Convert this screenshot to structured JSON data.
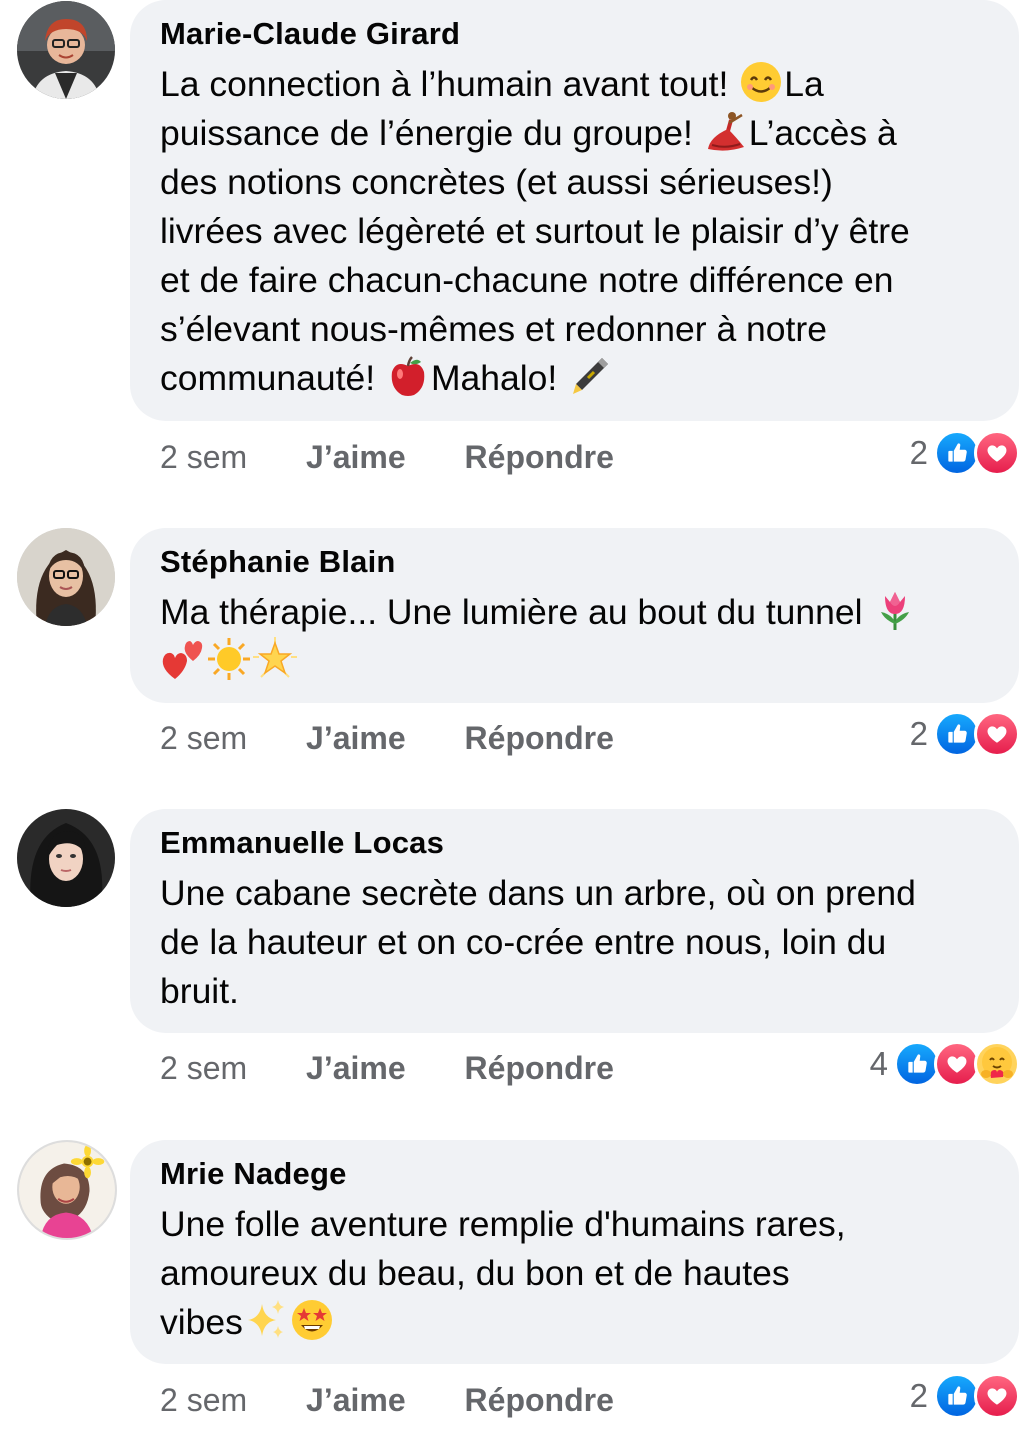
{
  "comments": [
    {
      "author": "Marie-Claude Girard",
      "text_parts": [
        "La connection à l’humain avant tout! ",
        "La\npuissance de l’énergie du groupe! ",
        "L’accès à\ndes notions concrètes (et aussi sérieuses!)\nlivrées avec légèreté et surtout le plaisir d’y être\net de faire chacun-chacune notre différence en\ns’élevant nous-mêmes et redonner à notre\ncommunauté! ",
        "Mahalo! "
      ],
      "emojis": [
        "smiling-face-emoji",
        "dancer-emoji",
        "apple-emoji",
        "pen-emoji"
      ],
      "time": "2 sem",
      "like_label": "J’aime",
      "reply_label": "Répondre",
      "reaction_count": "2",
      "reactions": [
        "like",
        "love"
      ]
    },
    {
      "author": "Stéphanie Blain",
      "text_parts": [
        "Ma thérapie... Une lumière au bout du tunnel "
      ],
      "emojis": [
        "tulip-emoji",
        "two-hearts-emoji",
        "sun-emoji",
        "glowing-star-emoji"
      ],
      "time": "2 sem",
      "like_label": "J’aime",
      "reply_label": "Répondre",
      "reaction_count": "2",
      "reactions": [
        "like",
        "love"
      ]
    },
    {
      "author": "Emmanuelle Locas",
      "text_parts": [
        "Une cabane secrète dans un arbre, où on prend\nde la hauteur et on co-crée entre nous, loin du\nbruit."
      ],
      "emojis": [],
      "time": "2 sem",
      "like_label": "J’aime",
      "reply_label": "Répondre",
      "reaction_count": "4",
      "reactions": [
        "like",
        "love",
        "care"
      ]
    },
    {
      "author": "Mrie Nadege",
      "text_parts": [
        "Une folle aventure remplie d'humains rares,\namoureux du beau, du bon et de hautes\nvibes"
      ],
      "emojis": [
        "sparkles-emoji",
        "star-struck-emoji"
      ],
      "time": "2 sem",
      "like_label": "J’aime",
      "reply_label": "Répondre",
      "reaction_count": "2",
      "reactions": [
        "like",
        "love"
      ]
    }
  ],
  "colors": {
    "bubble": "#f0f2f5",
    "meta_text": "#65676b",
    "like_blue": "#0165e1",
    "love_red": "#e61e4d"
  }
}
